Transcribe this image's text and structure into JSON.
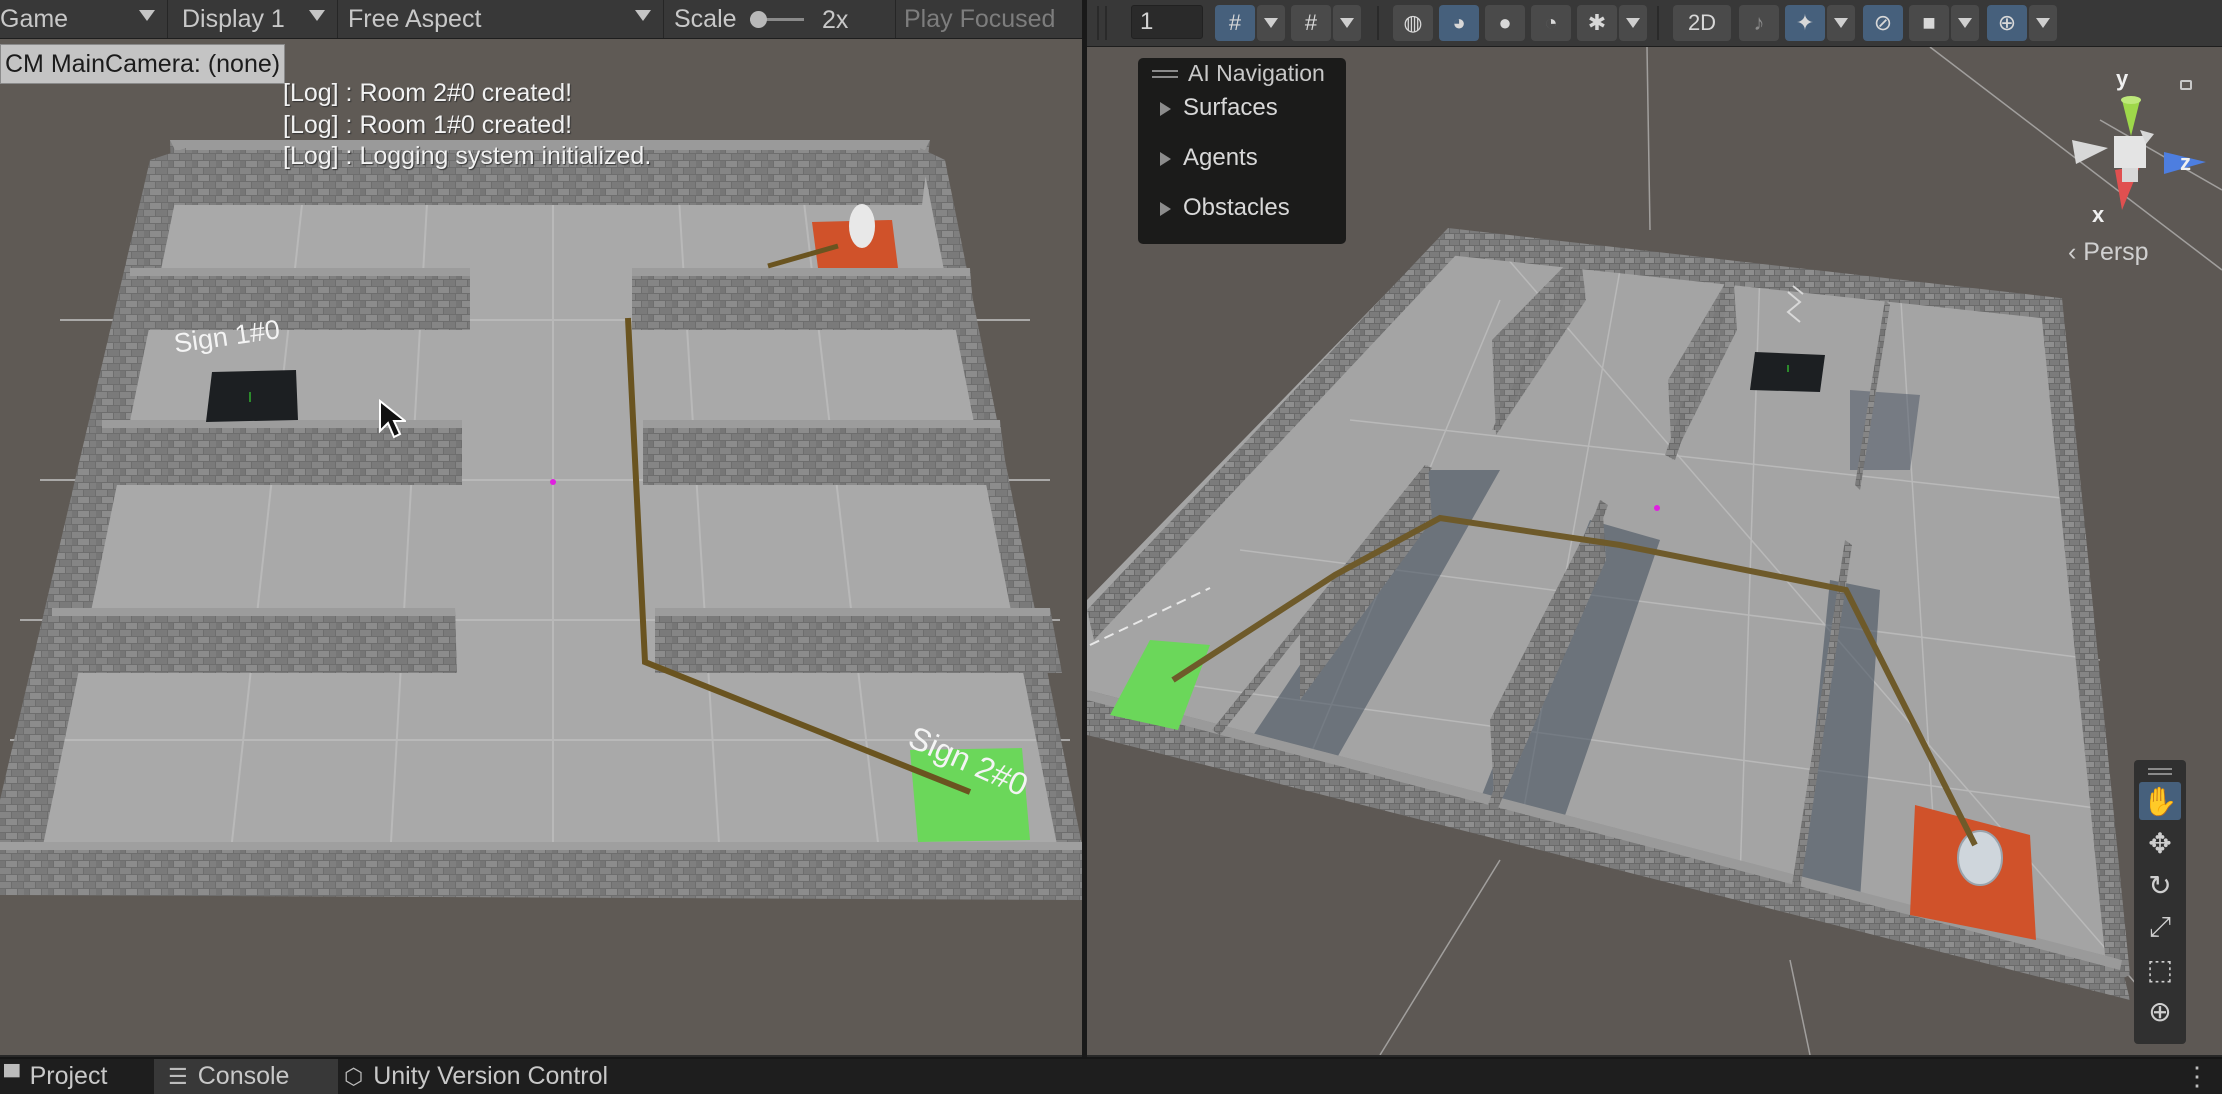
{
  "game_toolbar": {
    "view": "Game",
    "display": "Display 1",
    "aspect": "Free Aspect",
    "scale_label": "Scale",
    "scale_value": "2x",
    "play_focused": "Play Focused"
  },
  "game_view": {
    "camera_label": "CM MainCamera: (none)",
    "logs": [
      "[Log] : Room 2#0 created!",
      "[Log] : Room 1#0 created!",
      "[Log] : Logging system initialized."
    ],
    "sign1": "Sign 1#0",
    "sign2": "Sign 2#0"
  },
  "scene_toolbar": {
    "layer_value": "1",
    "mode_2d": "2D",
    "icons": [
      "grid-snap-icon",
      "increment-snap-icon",
      "wireframe-icon",
      "shaded-wireframe-icon",
      "shaded-icon",
      "unlit-icon",
      "debug-icon",
      "2d-toggle",
      "audio-mute-icon",
      "effects-icon",
      "visibility-icon",
      "camera-icon",
      "gizmos-icon"
    ]
  },
  "ai_navigation": {
    "title": "AI Navigation",
    "items": [
      "Surfaces",
      "Agents",
      "Obstacles"
    ]
  },
  "gizmo": {
    "y": "y",
    "z": "z",
    "x": "x",
    "projection": "Persp"
  },
  "tools": [
    "hand-tool",
    "move-tool",
    "rotate-tool",
    "scale-tool",
    "rect-tool",
    "transform-tool"
  ],
  "bottom_tabs": [
    {
      "label": "Project",
      "active": false
    },
    {
      "label": "Console",
      "active": true
    },
    {
      "label": "Unity Version Control",
      "active": false
    }
  ]
}
